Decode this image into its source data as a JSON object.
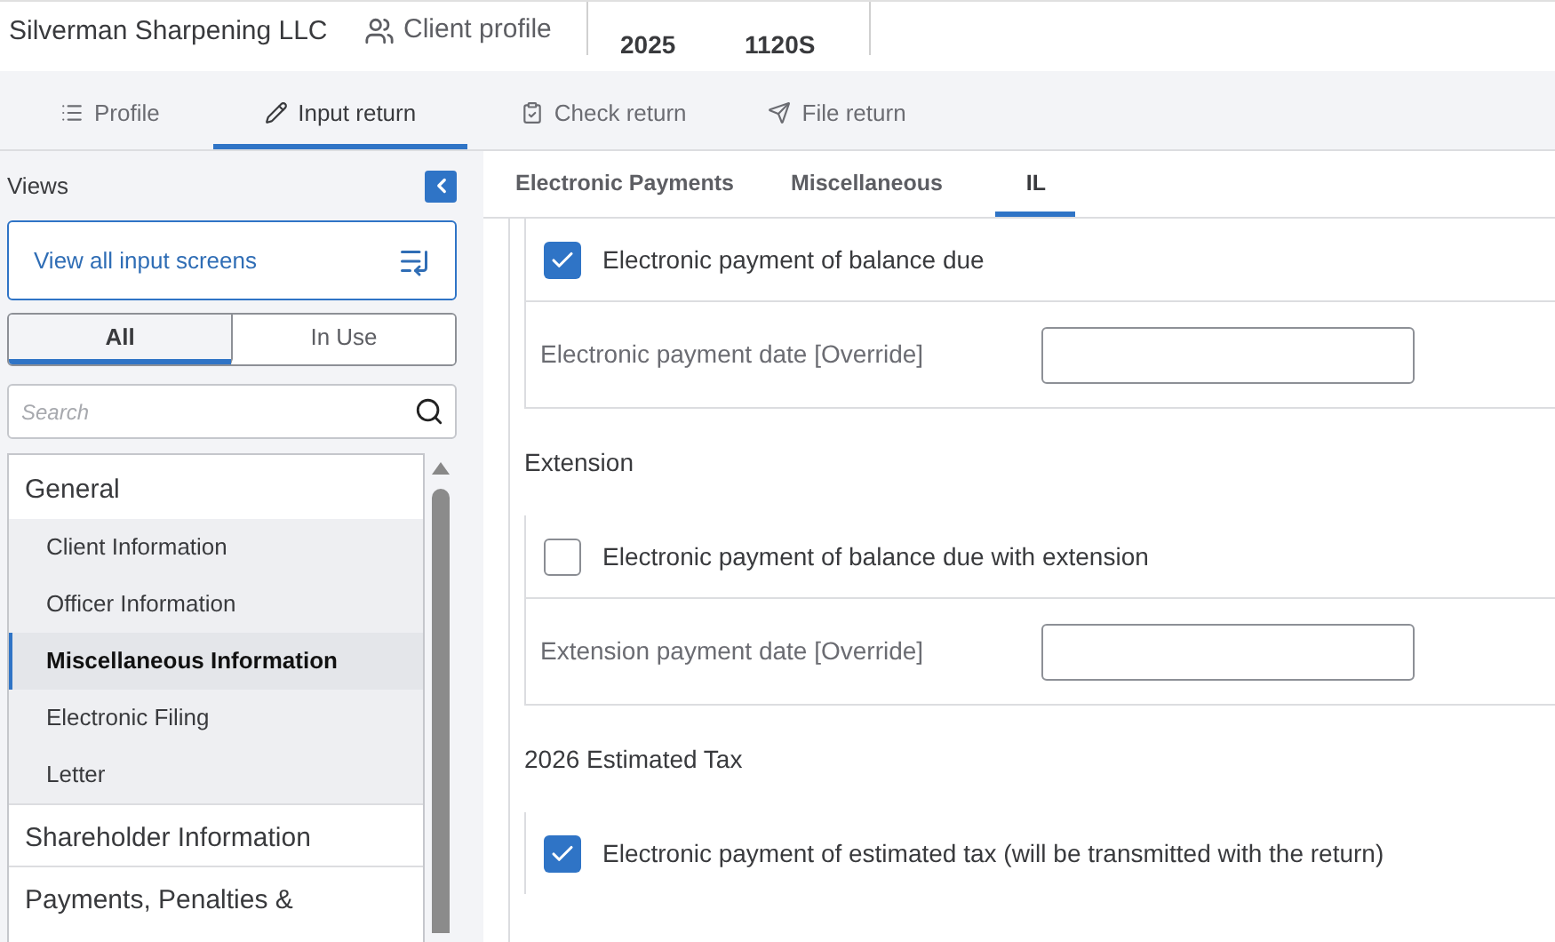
{
  "header": {
    "client_name": "Silverman Sharpening LLC",
    "profile_link": "Client profile",
    "tax_year": "2025",
    "return_type": "1120S"
  },
  "nav_tabs": [
    {
      "label": "Profile",
      "selected": false
    },
    {
      "label": "Input return",
      "selected": true
    },
    {
      "label": "Check return",
      "selected": false
    },
    {
      "label": "File return",
      "selected": false
    }
  ],
  "sidebar": {
    "title": "Views",
    "view_all": "View all input screens",
    "filter_tabs": [
      {
        "label": "All",
        "selected": true
      },
      {
        "label": "In Use",
        "selected": false
      }
    ],
    "search": {
      "placeholder": "Search"
    },
    "tree": [
      {
        "label": "General",
        "expanded": true,
        "children": [
          {
            "label": "Client Information",
            "selected": false
          },
          {
            "label": "Officer Information",
            "selected": false
          },
          {
            "label": "Miscellaneous Information",
            "selected": true
          },
          {
            "label": "Electronic Filing",
            "selected": false
          },
          {
            "label": "Letter",
            "selected": false
          }
        ]
      },
      {
        "label": "Shareholder Information",
        "expanded": false
      },
      {
        "label": "Payments, Penalties &",
        "expanded": false
      }
    ]
  },
  "form_tabs": [
    {
      "label": "Electronic Payments",
      "selected": false
    },
    {
      "label": "Miscellaneous",
      "selected": false
    },
    {
      "label": "IL",
      "selected": true
    }
  ],
  "sections": [
    {
      "fields": [
        {
          "kind": "checkbox",
          "label": "Electronic payment of balance due",
          "checked": true
        },
        {
          "kind": "date",
          "label": "Electronic payment date [Override]"
        }
      ]
    },
    {
      "title": "Extension",
      "fields": [
        {
          "kind": "checkbox",
          "label": "Electronic payment of balance due with extension",
          "checked": false
        },
        {
          "kind": "date",
          "label": "Extension payment date [Override]"
        }
      ]
    },
    {
      "title": "2026 Estimated Tax",
      "fields": [
        {
          "kind": "checkbox",
          "label": "Electronic payment of estimated tax (will be transmitted with the return)",
          "checked": true
        }
      ]
    }
  ]
}
